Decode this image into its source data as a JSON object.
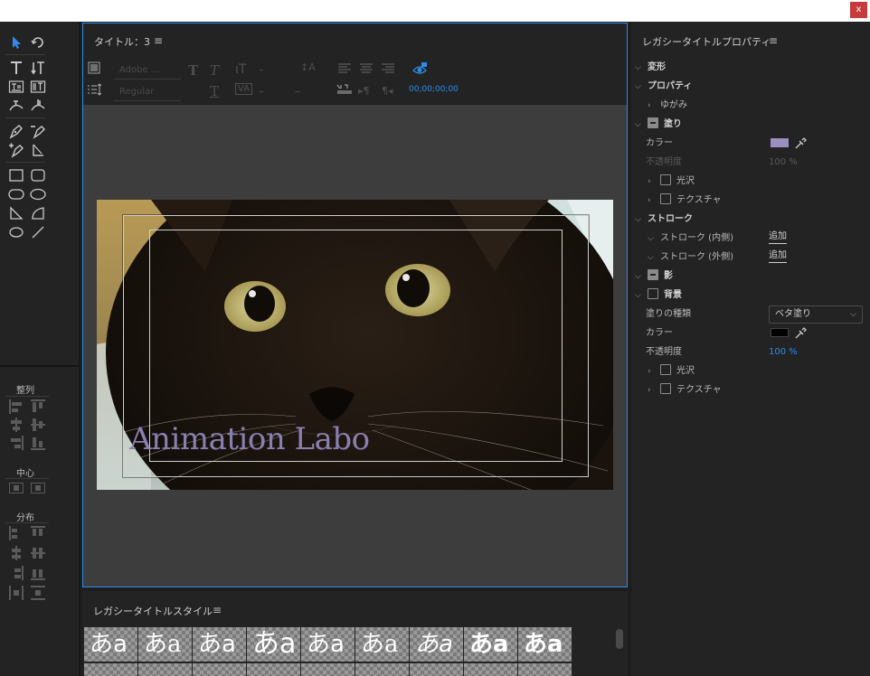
{
  "window": {
    "close_label": "x"
  },
  "tools": {
    "align_label": "整列",
    "center_label": "中心",
    "distribute_label": "分布"
  },
  "title_panel": {
    "title": "タイトル：3",
    "menu_icon": "≡",
    "font_family": "Adobe ...",
    "font_style": "Regular",
    "timecode": "00;00;00;00",
    "dash": "–",
    "overlay_text": "Animation Labo"
  },
  "styles_panel": {
    "title": "レガシータイトルスタイル",
    "menu_icon": "≡",
    "swatches": [
      "あa",
      "あa",
      "あa",
      "あa",
      "あa",
      "あa",
      "あa",
      "あa",
      "あa"
    ]
  },
  "props_panel": {
    "title": "レガシータイトルプロパティ",
    "menu_icon": "≡",
    "transform": "変形",
    "properties": "プロパティ",
    "distort": "ゆがみ",
    "fill": "塗り",
    "color_label": "カラー",
    "opacity_label": "不透明度",
    "opacity_dim": "100 %",
    "sheen": "光沢",
    "texture": "テクスチャ",
    "strokes": "ストローク",
    "inner_stroke": "ストローク (内側)",
    "outer_stroke": "ストローク (外側)",
    "add": "追加",
    "shadow": "影",
    "background": "背景",
    "fill_type_label": "塗りの種類",
    "fill_type_value": "ベタ塗り",
    "bg_color_label": "カラー",
    "bg_opacity_label": "不透明度",
    "bg_opacity_value": "100 %",
    "bg_sheen": "光沢",
    "bg_texture": "テクスチャ",
    "fill_color": "#9a8fc0",
    "bg_color": "#000000",
    "accent": "#2d8ceb"
  }
}
